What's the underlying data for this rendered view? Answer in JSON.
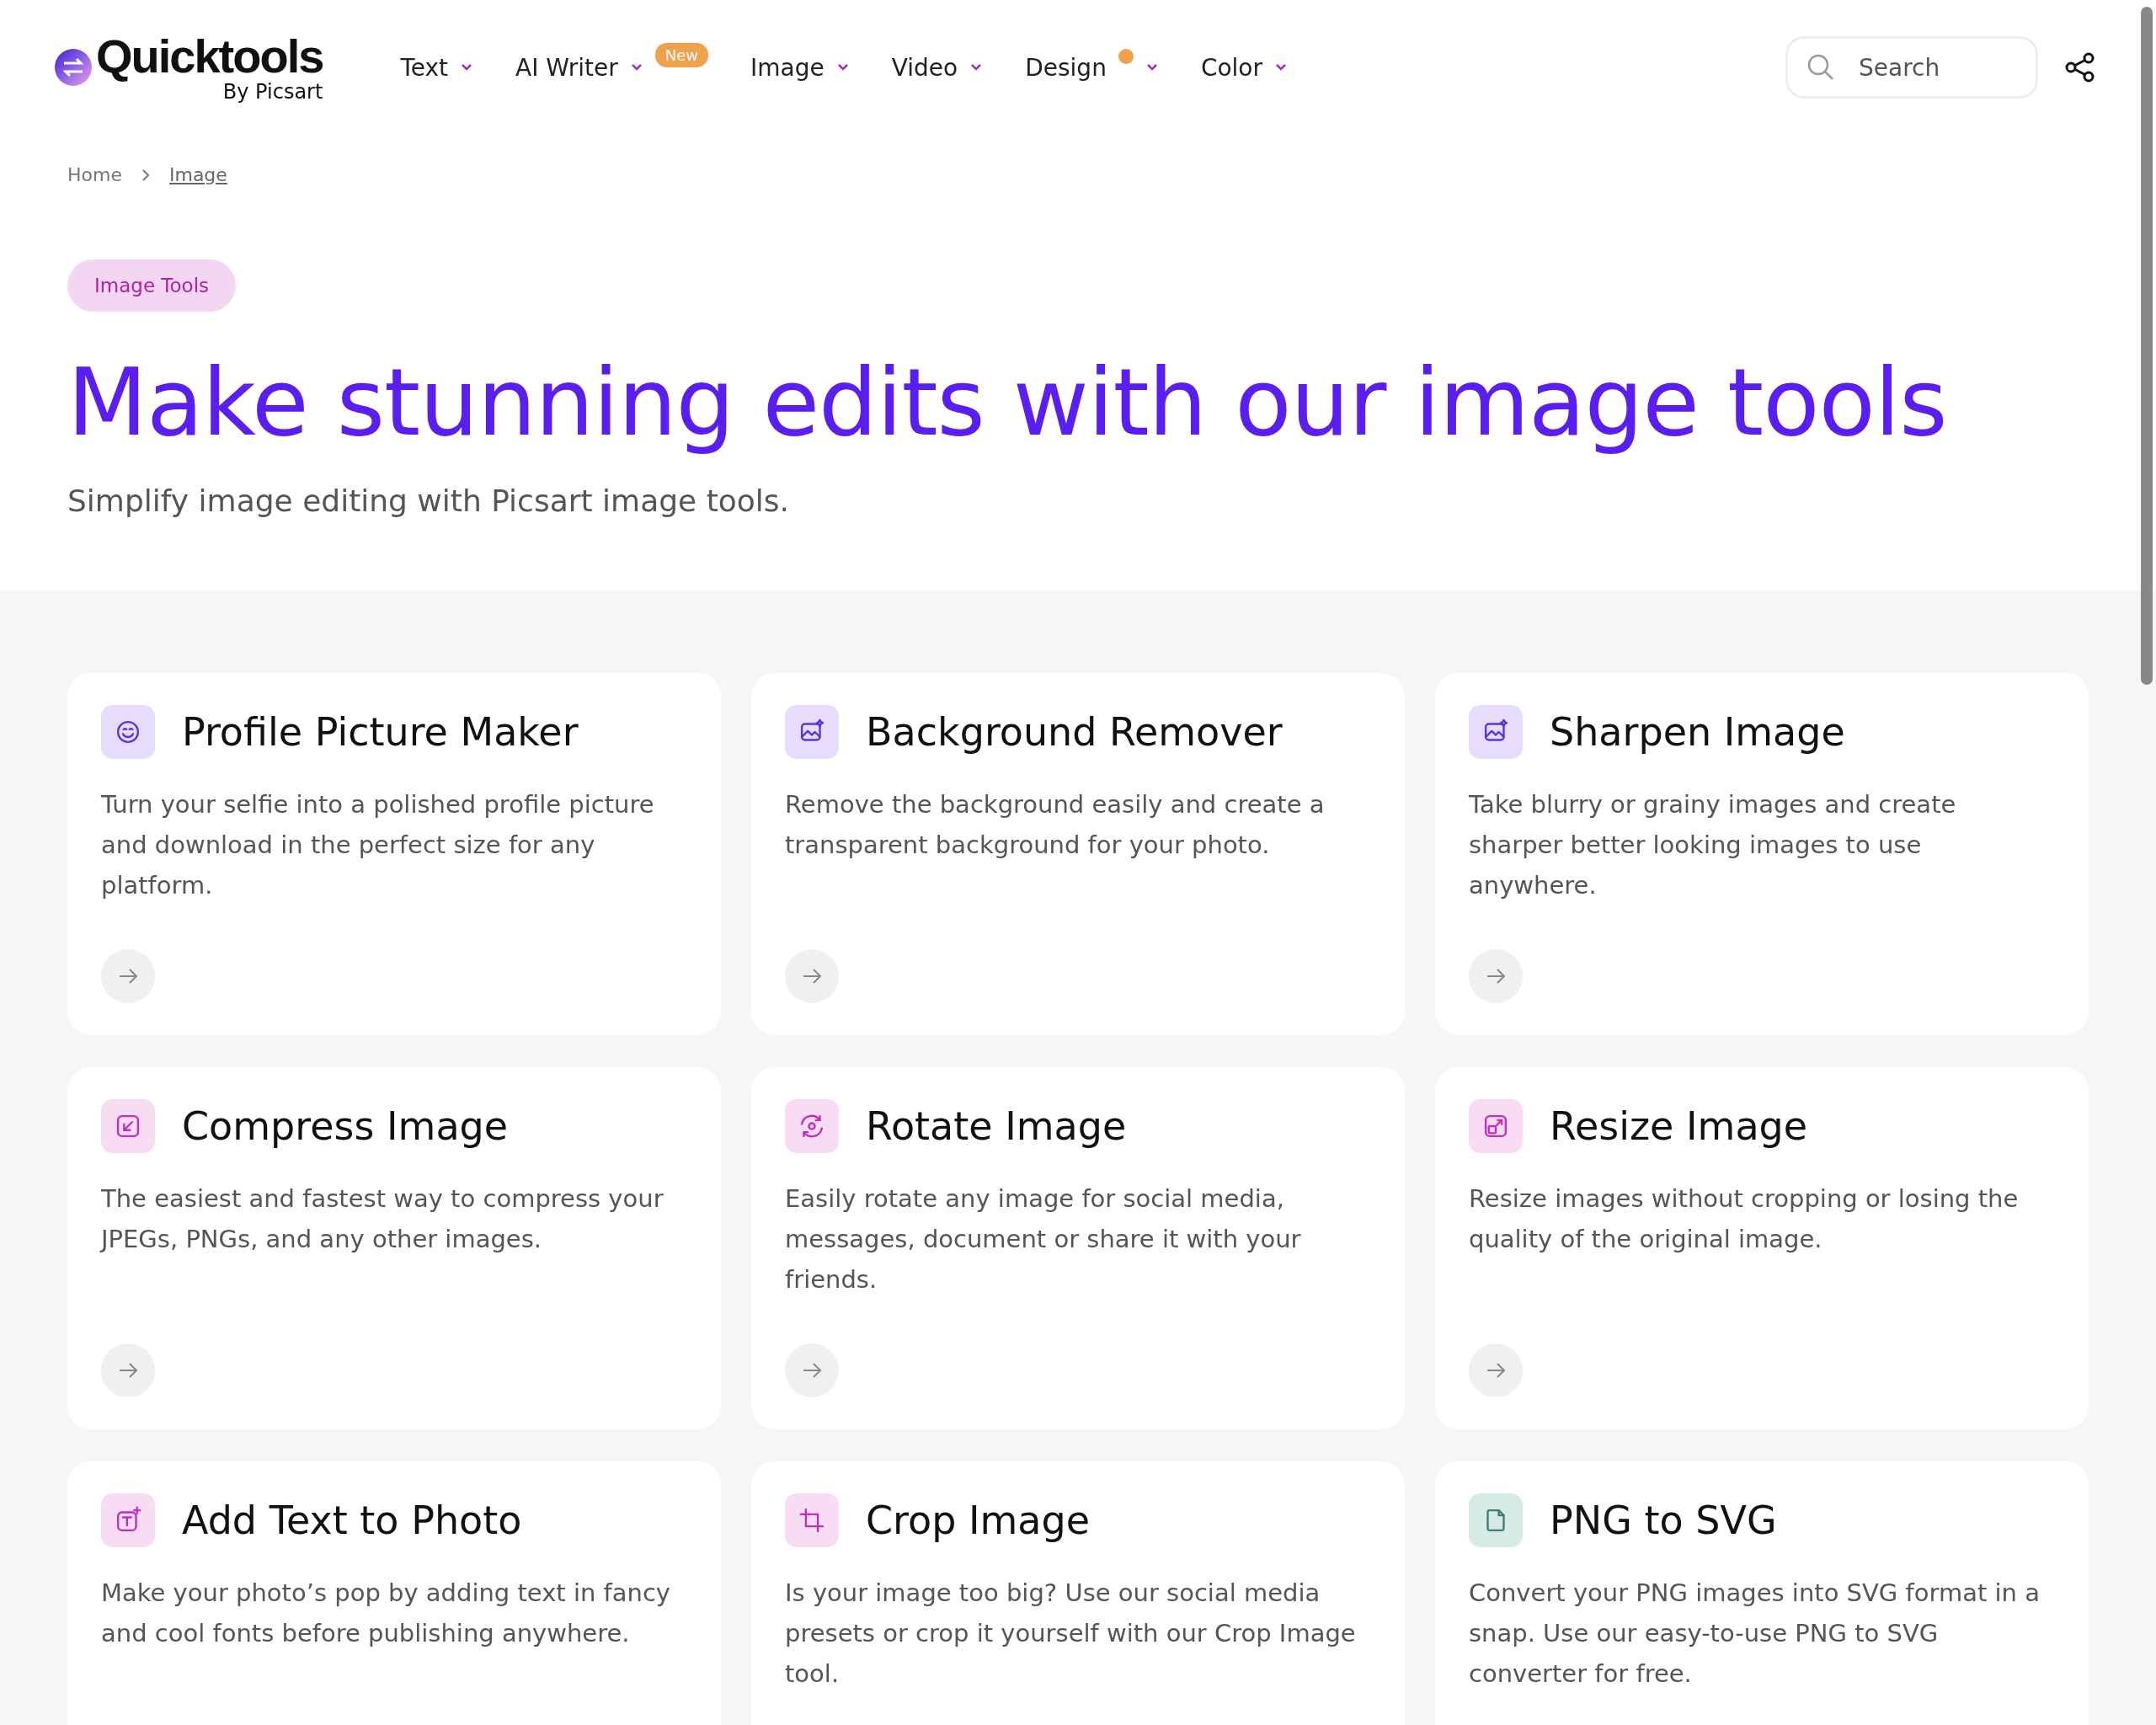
{
  "header": {
    "logo": {
      "name": "Quicktools",
      "byline": "By Picsart"
    },
    "nav": [
      {
        "label": "Text",
        "dot": false
      },
      {
        "label": "AI Writer",
        "badge": "New",
        "dot": false
      },
      {
        "label": "Image",
        "dot": false
      },
      {
        "label": "Video",
        "dot": false
      },
      {
        "label": "Design",
        "dot": true
      },
      {
        "label": "Color",
        "dot": false
      }
    ],
    "search": {
      "placeholder": "Search"
    }
  },
  "breadcrumb": [
    {
      "label": "Home",
      "current": false
    },
    {
      "label": "Image",
      "current": true
    }
  ],
  "hero": {
    "tag": "Image Tools",
    "title": "Make stunning edits with our image tools",
    "subtitle": "Simplify image editing with Picsart image tools."
  },
  "cards": [
    {
      "kind": "smile",
      "color": "#e6dcfc",
      "title": "Profile Picture Maker",
      "description": "Turn your selfie into a polished profile picture and download in the perfect size for any platform."
    },
    {
      "kind": "image",
      "color": "#e6dcfc",
      "title": "Background Remover",
      "description": "Remove the background easily and create a transparent background for your photo."
    },
    {
      "kind": "image",
      "color": "#e6dcfc",
      "title": "Sharpen Image",
      "description": "Take blurry or grainy images and create sharper better looking images to use anywhere."
    },
    {
      "kind": "compress",
      "color": "#f7dcf4",
      "title": "Compress Image",
      "description": "The easiest and fastest way to compress your JPEGs, PNGs, and any other images."
    },
    {
      "kind": "rotate",
      "color": "#f7dcf4",
      "title": "Rotate Image",
      "description": "Easily rotate any image for social media, messages, document or share it with your friends."
    },
    {
      "kind": "resize",
      "color": "#f7dcf4",
      "title": "Resize Image",
      "description": "Resize images without cropping or losing the quality of the original image."
    },
    {
      "kind": "text",
      "color": "#f7dcf4",
      "title": "Add Text to Photo",
      "description": "Make your photo’s pop by adding text in fancy and cool fonts before publishing anywhere."
    },
    {
      "kind": "crop",
      "color": "#f7dcf4",
      "title": "Crop Image",
      "description": "Is your image too big? Use our social media presets or crop it yourself with our Crop Image tool."
    },
    {
      "kind": "file",
      "color": "#d6ebe6",
      "title": "PNG to SVG",
      "description": "Convert your PNG images into SVG format in a snap. Use our easy-to-use PNG to SVG converter for free."
    }
  ]
}
